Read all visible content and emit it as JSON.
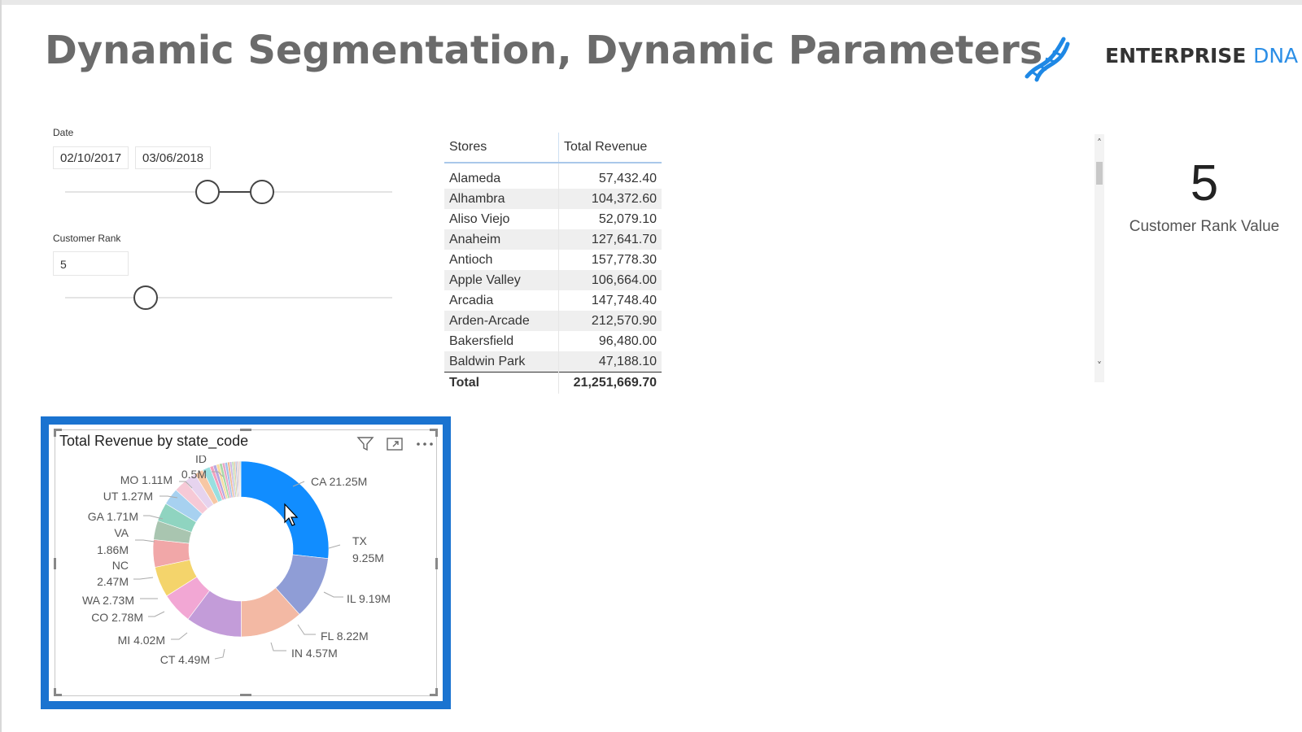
{
  "page": {
    "title": "Dynamic Segmentation, Dynamic Parameters",
    "logo": {
      "word1": "ENTERPRISE",
      "word2": "DNA"
    }
  },
  "date_slicer": {
    "label": "Date",
    "start": "02/10/2017",
    "end": "03/06/2018"
  },
  "rank_slicer": {
    "label": "Customer Rank",
    "value": "5"
  },
  "stores_table": {
    "headers": [
      "Stores",
      "Total Revenue"
    ],
    "rows": [
      [
        "Alameda",
        "57,432.40"
      ],
      [
        "Alhambra",
        "104,372.60"
      ],
      [
        "Aliso Viejo",
        "52,079.10"
      ],
      [
        "Anaheim",
        "127,641.70"
      ],
      [
        "Antioch",
        "157,778.30"
      ],
      [
        "Apple Valley",
        "106,664.00"
      ],
      [
        "Arcadia",
        "147,748.40"
      ],
      [
        "Arden-Arcade",
        "212,570.90"
      ],
      [
        "Bakersfield",
        "96,480.00"
      ],
      [
        "Baldwin Park",
        "47,188.10"
      ]
    ],
    "total_label": "Total",
    "total_value": "21,251,669.70"
  },
  "card": {
    "value": "5",
    "label": "Customer Rank Value"
  },
  "icons": {
    "filter": "filter-icon",
    "focus": "focus-mode-icon",
    "more": "more-options-icon",
    "scroll_up": "chevron-up-icon",
    "scroll_down": "chevron-down-icon",
    "logo": "dna-helix-icon"
  },
  "chart_data": {
    "type": "pie",
    "title": "Total Revenue by state_code",
    "donut": true,
    "slices": [
      {
        "label": "CA",
        "value": 21.25,
        "text": "CA 21.25M",
        "color": "#118dff"
      },
      {
        "label": "TX",
        "value": 9.25,
        "text": "9.25M",
        "color": "#8f9dd6"
      },
      {
        "label": "IL",
        "value": 9.19,
        "text": "IL 9.19M",
        "color": "#f3b9a4"
      },
      {
        "label": "FL",
        "value": 8.22,
        "text": "FL 8.22M",
        "color": "#c39cd9"
      },
      {
        "label": "IN",
        "value": 4.57,
        "text": "IN 4.57M",
        "color": "#f2a7d4"
      },
      {
        "label": "CT",
        "value": 4.49,
        "text": "CT 4.49M",
        "color": "#f4d46b"
      },
      {
        "label": "MI",
        "value": 4.02,
        "text": "MI 4.02M",
        "color": "#f1a7a8"
      },
      {
        "label": "CO",
        "value": 2.78,
        "text": "CO 2.78M",
        "color": "#a9c5b0"
      },
      {
        "label": "WA",
        "value": 2.73,
        "text": "WA 2.73M",
        "color": "#8fd4c0"
      },
      {
        "label": "NC",
        "value": 2.47,
        "text": "2.47M",
        "color": "#a7d1f0"
      },
      {
        "label": "VA",
        "value": 1.86,
        "text": "1.86M",
        "color": "#f6c9d6"
      },
      {
        "label": "GA",
        "value": 1.71,
        "text": "GA 1.71M",
        "color": "#e6d3ee"
      },
      {
        "label": "UT",
        "value": 1.27,
        "text": "UT 1.27M",
        "color": "#f7c7a4"
      },
      {
        "label": "MO",
        "value": 1.11,
        "text": "MO 1.11M",
        "color": "#98dfe0"
      },
      {
        "label": "ID",
        "value": 0.5,
        "text": "0.5M",
        "color": "#f3a0bd"
      },
      {
        "label": "",
        "value": 0.48,
        "text": "",
        "color": "#b4a7e0"
      },
      {
        "label": "",
        "value": 0.45,
        "text": "",
        "color": "#f7dca0"
      },
      {
        "label": "",
        "value": 0.42,
        "text": "",
        "color": "#a8d8a8"
      },
      {
        "label": "",
        "value": 0.4,
        "text": "",
        "color": "#e8a6c8"
      },
      {
        "label": "",
        "value": 0.37,
        "text": "",
        "color": "#9ec0e8"
      },
      {
        "label": "",
        "value": 0.34,
        "text": "",
        "color": "#f0b890"
      },
      {
        "label": "",
        "value": 0.3,
        "text": "",
        "color": "#c8b4e4"
      },
      {
        "label": "",
        "value": 0.27,
        "text": "",
        "color": "#b8dcb4"
      },
      {
        "label": "",
        "value": 0.24,
        "text": "",
        "color": "#e4c49c"
      },
      {
        "label": "",
        "value": 0.21,
        "text": "",
        "color": "#a4b8d8"
      },
      {
        "label": "",
        "value": 0.18,
        "text": "",
        "color": "#d8a8b8"
      },
      {
        "label": "",
        "value": 0.16,
        "text": "",
        "color": "#bcbcbc"
      },
      {
        "label": "",
        "value": 0.14,
        "text": "",
        "color": "#e8b4a0"
      },
      {
        "label": "",
        "value": 0.12,
        "text": "",
        "color": "#9cc4c0"
      }
    ],
    "ta_labels": [
      {
        "slice": "ID",
        "text": "ID"
      },
      {
        "slice": "TX",
        "text": "TX"
      },
      {
        "slice": "VA",
        "text": "VA"
      },
      {
        "slice": "NC",
        "text": "NC"
      }
    ]
  }
}
